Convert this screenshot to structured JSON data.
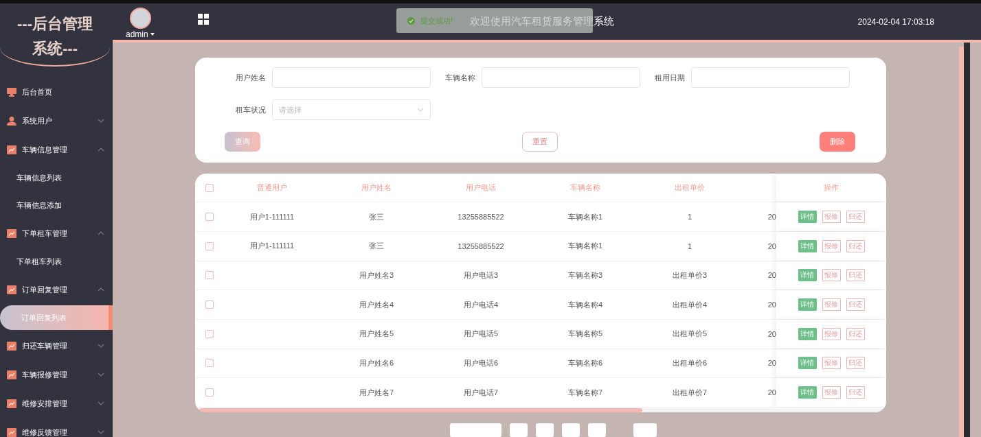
{
  "logo": {
    "title": "---后台管理系统---"
  },
  "user": {
    "name": "admin"
  },
  "header": {
    "title": "欢迎使用汽车租赁服务管理系统",
    "datetime": "2024-02-04 17:03:18"
  },
  "toast": {
    "message": "提交成功!"
  },
  "sidebar": {
    "items": [
      {
        "label": "后台首页",
        "kind": "home",
        "selected": false
      },
      {
        "label": "系统用户",
        "kind": "user",
        "expanded": false,
        "selected": false
      },
      {
        "label": "车辆信息管理",
        "kind": "module",
        "expanded": true,
        "selected": false,
        "children": [
          {
            "label": "车辆信息列表",
            "selected": false
          },
          {
            "label": "车辆信息添加",
            "selected": false
          }
        ]
      },
      {
        "label": "下单租车管理",
        "kind": "module",
        "expanded": true,
        "selected": false,
        "children": [
          {
            "label": "下单租车列表",
            "selected": false
          }
        ]
      },
      {
        "label": "订单回复管理",
        "kind": "module",
        "expanded": true,
        "selected": false,
        "children": [
          {
            "label": "订单回复列表",
            "selected": true
          }
        ]
      },
      {
        "label": "归还车辆管理",
        "kind": "module",
        "expanded": false,
        "selected": false
      },
      {
        "label": "车辆报修管理",
        "kind": "module",
        "expanded": false,
        "selected": false
      },
      {
        "label": "维修安排管理",
        "kind": "module",
        "expanded": false,
        "selected": false
      },
      {
        "label": "维修反馈管理",
        "kind": "module",
        "expanded": false,
        "selected": false
      }
    ]
  },
  "search": {
    "fields": [
      {
        "label": "用户姓名",
        "kind": "input"
      },
      {
        "label": "车辆名称",
        "kind": "input"
      },
      {
        "label": "租用日期",
        "kind": "input"
      },
      {
        "label": "租车状况",
        "kind": "select",
        "placeholder": "请选择"
      }
    ],
    "buttons": [
      {
        "label": "查询",
        "kind": "query"
      },
      {
        "label": "重置",
        "kind": "reset"
      },
      {
        "label": "删除",
        "kind": "delete"
      }
    ]
  },
  "table": {
    "columns": [
      "普通用户",
      "用户姓名",
      "用户电话",
      "车辆名称",
      "出租单价"
    ],
    "action_header": "操作",
    "all_checked": false,
    "rows": [
      {
        "checked": false,
        "cells": [
          "用户1-111111",
          "张三",
          "13255885522",
          "车辆名称1",
          "1",
          "20"
        ],
        "actions": [
          "详情",
          "报修",
          "归还"
        ]
      },
      {
        "checked": false,
        "cells": [
          "用户1-111111",
          "张三",
          "13255885522",
          "车辆名称1",
          "1",
          "20"
        ],
        "actions": [
          "详情",
          "报修",
          "归还"
        ]
      },
      {
        "checked": false,
        "cells": [
          "",
          "用户姓名3",
          "用户电话3",
          "车辆名称3",
          "出租单价3",
          "20"
        ],
        "actions": [
          "详情",
          "报修",
          "归还"
        ]
      },
      {
        "checked": false,
        "cells": [
          "",
          "用户姓名4",
          "用户电话4",
          "车辆名称4",
          "出租单价4",
          "20"
        ],
        "actions": [
          "详情",
          "报修",
          "归还"
        ]
      },
      {
        "checked": false,
        "cells": [
          "",
          "用户姓名5",
          "用户电话5",
          "车辆名称5",
          "出租单价5",
          "20"
        ],
        "actions": [
          "详情",
          "报修",
          "归还"
        ]
      },
      {
        "checked": false,
        "cells": [
          "",
          "用户姓名6",
          "用户电话6",
          "车辆名称6",
          "出租单价6",
          "20"
        ],
        "actions": [
          "详情",
          "报修",
          "归还"
        ]
      },
      {
        "checked": false,
        "cells": [
          "",
          "用户姓名7",
          "用户电话7",
          "车辆名称7",
          "出租单价7",
          "20"
        ],
        "actions": [
          "详情",
          "报修",
          "归还"
        ]
      }
    ]
  }
}
